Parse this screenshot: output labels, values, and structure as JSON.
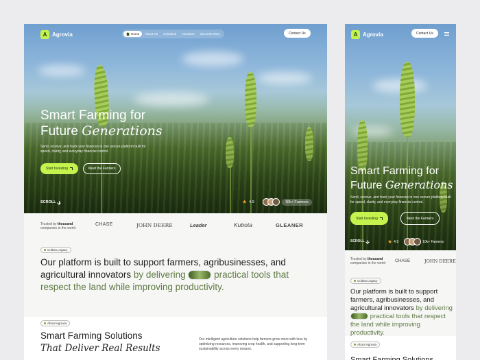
{
  "brand": {
    "name": "Agrovia",
    "logo_letter": "A"
  },
  "nav": {
    "items": [
      "Home",
      "About Us",
      "Solutions",
      "Investors",
      "Success Story"
    ],
    "contact_label": "Contact Us"
  },
  "hero": {
    "title_line1": "Smart Farming for",
    "title_line2_plain": "Future ",
    "title_line2_italic": "Generations",
    "subtitle": "Send, receive, and track your finances in one secure platform built for speed, clarity, and everyday financial control.",
    "primary_cta": "Start Investing",
    "secondary_cta": "Meet the Farmers",
    "scroll_label": "SCROLL",
    "rating": "4.9",
    "farmers_label": "10k+ Farmers"
  },
  "trusted": {
    "prefix": "Trusted by",
    "bold": "thousand",
    "suffix": "companies in the world",
    "logos": [
      "CHASE",
      "JOHN DEERE",
      "Leader",
      "Kubota",
      "GLEANER"
    ]
  },
  "mission": {
    "tag": "Cultiva Legacy",
    "text_main": "Our platform is built to support farmers, agribusinesses, and agricultural innovators",
    "text_muted_1": "by delivering",
    "text_muted_2": "practical tools that respect the land while improving productivity."
  },
  "about": {
    "tag": "About Agrovia",
    "title_plain": "Smart Farming Solutions",
    "title_italic": "That Deliver Real Results",
    "description": "Our intelligent agriculture solutions help farmers grow more with less by optimizing resources, improving crop health, and supporting long-term sustainability across every season."
  },
  "colors": {
    "accent": "#c6f24e",
    "muted_green": "#5f7a45",
    "star": "#f5a623"
  }
}
